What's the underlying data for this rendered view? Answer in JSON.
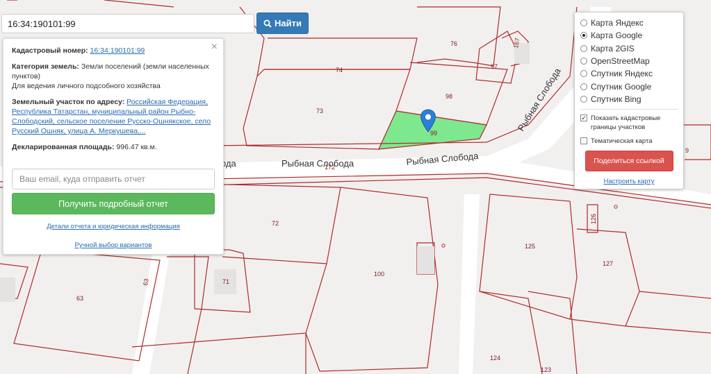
{
  "search": {
    "value": "16:34:190101:99",
    "button_label": "Найти"
  },
  "info": {
    "cadastral_label": "Кадастровый номер:",
    "cadastral_value": "16:34:190101:99",
    "category_label": "Категория земель:",
    "category_value": "Земли поселений (земли населенных пунктов)",
    "usage": "Для ведения личного подсобного хозяйства",
    "address_label": "Земельный участок по адресу:",
    "address_value": "Российская Федерация, Республика Татарстан, муниципальный район Рыбно-Слободский, сельское поселение Русско-Ошнякское, село Русский Ошняк, улица А. Меркушева,...",
    "area_label": "Декларированная площадь:",
    "area_value": "996.47 кв.м.",
    "email_placeholder": "Ваш email, куда отправить отчет",
    "report_button": "Получить подробный отчет",
    "details_link": "Детали отчета и юридическая информация",
    "manual_link": "Ручной выбор вариантов",
    "close_symbol": "×"
  },
  "layers": {
    "options": [
      {
        "label": "Карта Яндекс",
        "selected": false
      },
      {
        "label": "Карта Google",
        "selected": true
      },
      {
        "label": "Карта 2GIS",
        "selected": false
      },
      {
        "label": "OpenStreetMap",
        "selected": false
      },
      {
        "label": "Спутник Яндекс",
        "selected": false
      },
      {
        "label": "Спутник Google",
        "selected": false
      },
      {
        "label": "Спутник Bing",
        "selected": false
      }
    ],
    "show_borders_label": "Показать кадастровые границы участков",
    "show_borders_checked": true,
    "thematic_label": "Тематическая карта",
    "thematic_checked": false,
    "share_button": "Поделиться ссылкой",
    "setup_link": "Настроить карту"
  },
  "map": {
    "streets": [
      "Рыбная Слобода",
      "Рыбная Слобода",
      "Рыбная Слобода",
      "ода"
    ],
    "parcels": [
      "76",
      "167",
      "97",
      "74",
      "98",
      "73",
      "99",
      "172",
      "72",
      "100",
      "71",
      "63",
      "63",
      "125",
      "127",
      "126",
      "124",
      "123",
      "9"
    ],
    "colors": {
      "boundary": "#b02a2a",
      "selected_fill": "#7ee88e",
      "background": "#f2f0ef",
      "road": "#ffffff",
      "pin": "#2c7fd6"
    }
  }
}
